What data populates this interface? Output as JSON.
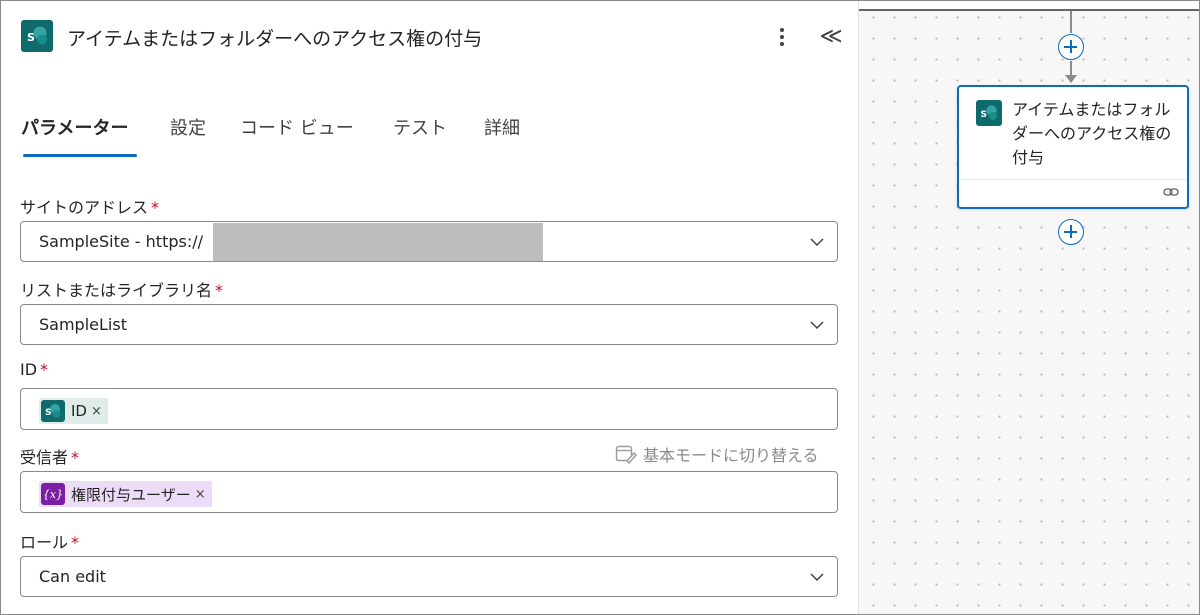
{
  "header": {
    "title": "アイテムまたはフォルダーへのアクセス権の付与",
    "logo_icon": "sharepoint-icon",
    "more_icon": "more-vertical-icon",
    "collapse_label": "≪"
  },
  "tabs": [
    {
      "label": "パラメーター",
      "active": true
    },
    {
      "label": "設定"
    },
    {
      "label": "コード ビュー"
    },
    {
      "label": "テスト"
    },
    {
      "label": "詳細"
    }
  ],
  "fields": {
    "site": {
      "label": "サイトのアドレス",
      "required_mark": "*",
      "value": "SampleSite - https://"
    },
    "list": {
      "label": "リストまたはライブラリ名",
      "required_mark": "*",
      "value": "SampleList"
    },
    "id": {
      "label": "ID",
      "required_mark": "*",
      "token": "ID",
      "token_close": "×"
    },
    "recipient": {
      "label": "受信者",
      "required_mark": "*",
      "token": "権限付与ユーザー",
      "token_close": "×",
      "token_icon_text": "{x}"
    },
    "role": {
      "label": "ロール",
      "required_mark": "*",
      "value": "Can edit"
    }
  },
  "basic_mode": {
    "label": "基本モードに切り替える"
  },
  "canvas": {
    "card_title": "アイテムまたはフォルダーへのアクセス権の付与"
  },
  "colors": {
    "accent": "#0f6cbd",
    "sharepoint": "#0f6b6b",
    "variable": "#7a1fa2",
    "required": "#c50f1f"
  }
}
